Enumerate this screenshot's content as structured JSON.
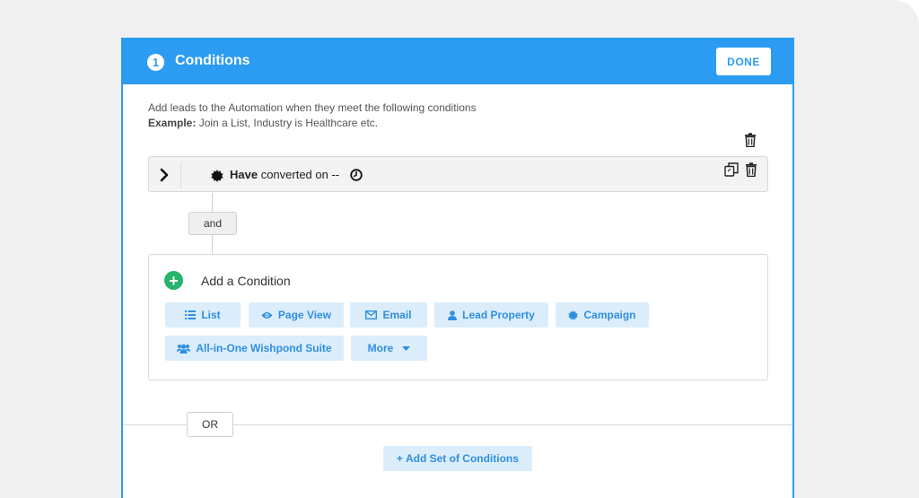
{
  "header": {
    "step_number": "1",
    "title": "Conditions",
    "done_label": "DONE",
    "accent_color": "#2b9cf2"
  },
  "description": {
    "line1": "Add leads to the Automation when they meet the following conditions",
    "example_label": "Example:",
    "example_text": " Join a List, Industry is Healthcare etc."
  },
  "condition": {
    "keyword": "Have",
    "text": " converted on --",
    "icons": [
      "chevron-right-icon",
      "gear-icon",
      "clock-icon",
      "copy-icon",
      "trash-icon"
    ]
  },
  "connector": {
    "and_label": "and"
  },
  "add_condition": {
    "title": "Add a Condition",
    "plus": "+",
    "chips": [
      {
        "label": "List",
        "icon": "list-icon"
      },
      {
        "label": "Page View",
        "icon": "eye-icon"
      },
      {
        "label": "Email",
        "icon": "envelope-icon"
      },
      {
        "label": "Lead Property",
        "icon": "user-icon"
      },
      {
        "label": "Campaign",
        "icon": "gear-icon"
      },
      {
        "label": "All-in-One Wishpond Suite",
        "icon": "users-icon"
      },
      {
        "label": "More",
        "icon": "caret-down-icon"
      }
    ]
  },
  "or_label": "OR",
  "add_set_label": "+ Add Set of Conditions"
}
